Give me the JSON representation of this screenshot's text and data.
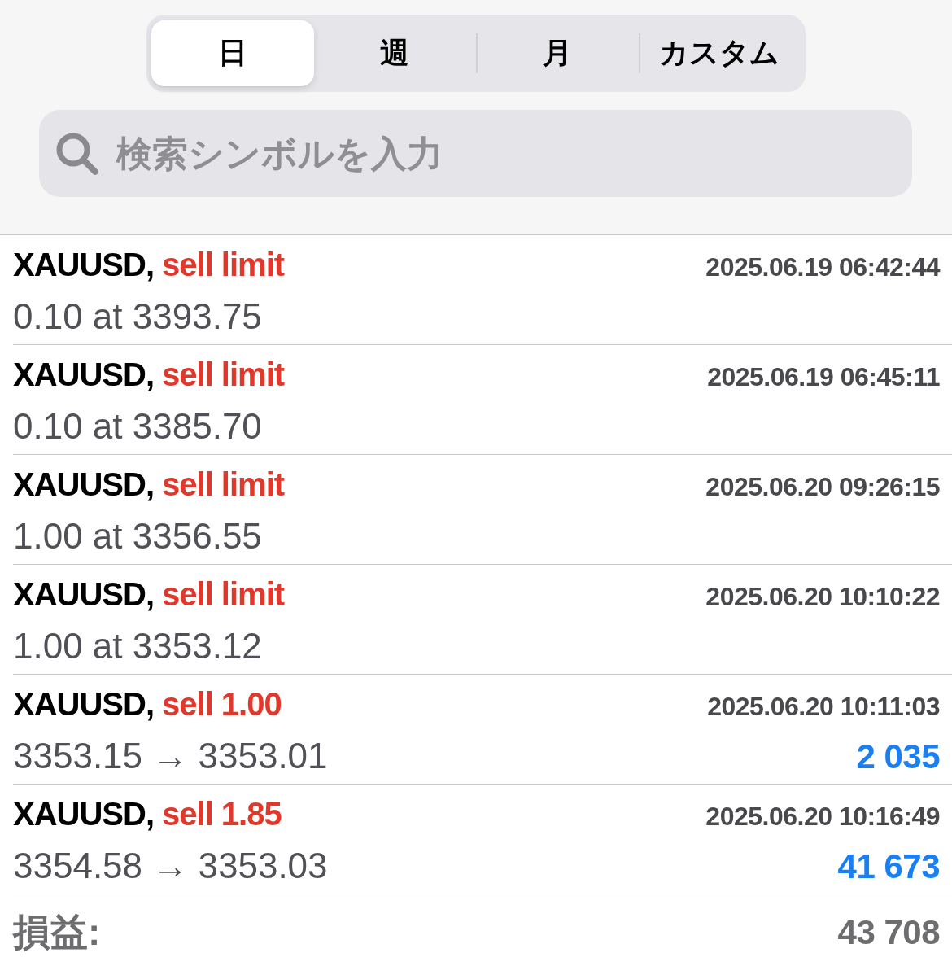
{
  "period_tabs": [
    {
      "label": "日",
      "selected": true
    },
    {
      "label": "週",
      "selected": false
    },
    {
      "label": "月",
      "selected": false
    },
    {
      "label": "カスタム",
      "selected": false
    }
  ],
  "search": {
    "placeholder": "検索シンボルを入力"
  },
  "orders": [
    {
      "symbol": "XAUUSD,",
      "type": "sell limit",
      "time": "2025.06.19 06:42:44",
      "detail": "0.10 at 3393.75"
    },
    {
      "symbol": "XAUUSD,",
      "type": "sell limit",
      "time": "2025.06.19 06:45:11",
      "detail": "0.10 at 3385.70"
    },
    {
      "symbol": "XAUUSD,",
      "type": "sell limit",
      "time": "2025.06.20 09:26:15",
      "detail": "1.00 at 3356.55"
    },
    {
      "symbol": "XAUUSD,",
      "type": "sell limit",
      "time": "2025.06.20 10:10:22",
      "detail": "1.00 at 3353.12"
    },
    {
      "symbol": "XAUUSD,",
      "type": "sell 1.00",
      "time": "2025.06.20 10:11:03",
      "detail": "3353.15 → 3353.01",
      "profit": "2 035"
    },
    {
      "symbol": "XAUUSD,",
      "type": "sell 1.85",
      "time": "2025.06.20 10:16:49",
      "detail": "3354.58 → 3353.03",
      "profit": "41 673"
    }
  ],
  "total": {
    "label": "損益:",
    "value": "43 708"
  }
}
